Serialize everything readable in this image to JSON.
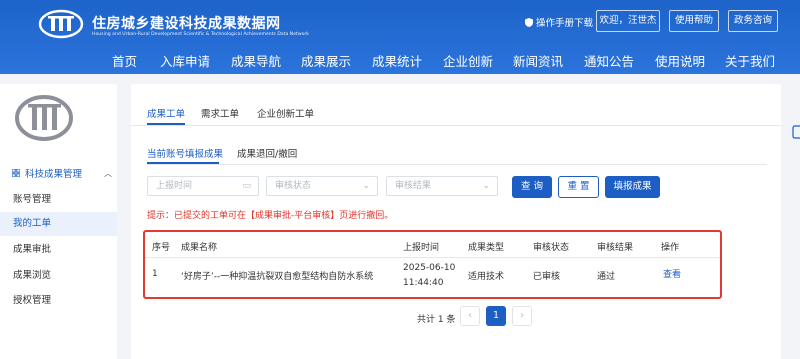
{
  "header": {
    "site_title": "住房城乡建设科技成果数据网",
    "site_subtitle": "Housing and Urban-Rural Development Scientific & Technological Achievements Data Network",
    "manual_link": "操作手册下载",
    "welcome": "欢迎，汪世杰",
    "help": "使用帮助",
    "consult": "政务咨询",
    "logo_icon": "logo-emblem",
    "manual_icon": "shield-icon"
  },
  "nav": {
    "items": [
      "首页",
      "入库申请",
      "成果导航",
      "成果展示",
      "成果统计",
      "企业创新",
      "新闻资讯",
      "通知公告",
      "使用说明",
      "关于我们"
    ]
  },
  "sidebar": {
    "group": "科技成果管理",
    "group_icon": "grid-icon",
    "items": [
      "账号管理",
      "我的工单",
      "成果审批",
      "成果浏览",
      "授权管理"
    ],
    "active_item": "我的工单"
  },
  "tabs": {
    "primary": [
      "成果工单",
      "需求工单",
      "企业创新工单"
    ],
    "secondary": [
      "当前账号填报成果",
      "成果退回/撤回"
    ]
  },
  "filters": {
    "date_placeholder": "上报时间",
    "status_placeholder": "审核状态",
    "result_placeholder": "审核结果",
    "search_button": "查 询",
    "reset_button": "重 置",
    "add_button": "填报成果"
  },
  "tip": "提示：已提交的工单可在【成果审批-平台审核】页进行撤回。",
  "table": {
    "headers": [
      "序号",
      "成果名称",
      "上报时间",
      "成果类型",
      "审核状态",
      "审核结果",
      "操作"
    ],
    "rows": [
      {
        "index": "1",
        "name": "‘好房子’--一种抑温抗裂双自愈型结构自防水系统",
        "date": "2025-06-10",
        "time": "11:44:40",
        "type": "适用技术",
        "status": "已审核",
        "result": "通过",
        "action": "查看"
      }
    ]
  },
  "pagination": {
    "total": "共计 1 条",
    "current_page": "1",
    "prev": "‹",
    "next": "›"
  },
  "colors": {
    "header_blue": "#2b74dc",
    "primary": "#1d5ec4",
    "tip_red": "#e0342a",
    "highlight_border": "#e23a33"
  }
}
